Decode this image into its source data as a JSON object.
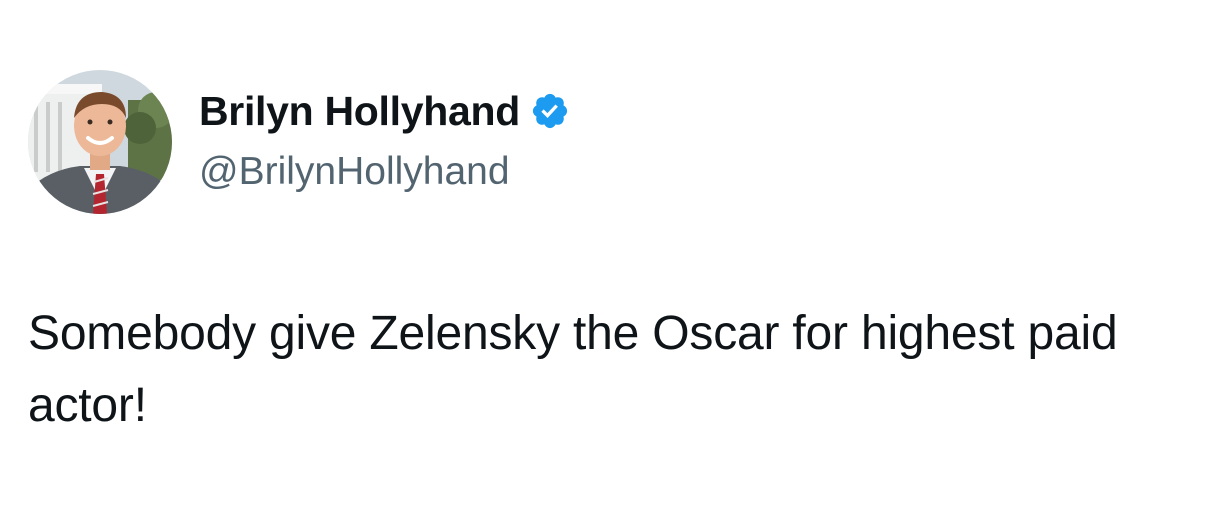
{
  "author": {
    "display_name": "Brilyn Hollyhand",
    "handle": "@BrilynHollyhand",
    "verified": true,
    "verified_color": "#1d9bf0",
    "avatar_icon": "profile-photo"
  },
  "tweet": {
    "text": "Somebody give Zelensky the Oscar for highest paid actor!"
  },
  "colors": {
    "text_primary": "#0f1419",
    "text_secondary": "#536471",
    "background": "#ffffff"
  }
}
